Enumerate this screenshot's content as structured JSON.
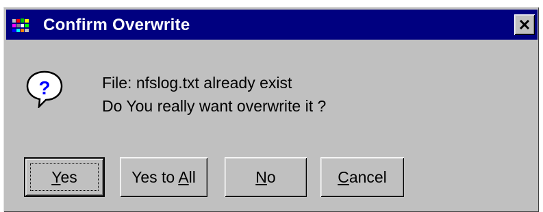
{
  "dialog": {
    "title": "Confirm Overwrite",
    "message_line1": "File:  nfslog.txt  already exist",
    "message_line2": "Do You really want overwrite it ?"
  },
  "icons": {
    "app": "application-icon",
    "close": "close-icon",
    "question": "question-balloon-icon"
  },
  "buttons": {
    "yes": {
      "label_before": "",
      "accel": "Y",
      "label_after": "es"
    },
    "yes_to_all": {
      "label_before": "Yes to ",
      "accel": "A",
      "label_after": "ll"
    },
    "no": {
      "label_before": "",
      "accel": "N",
      "label_after": "o"
    },
    "cancel": {
      "label_before": "",
      "accel": "C",
      "label_after": "ancel"
    }
  },
  "colors": {
    "title_bar": "#000080",
    "face": "#c0c0c0",
    "title_text": "#ffffff"
  }
}
